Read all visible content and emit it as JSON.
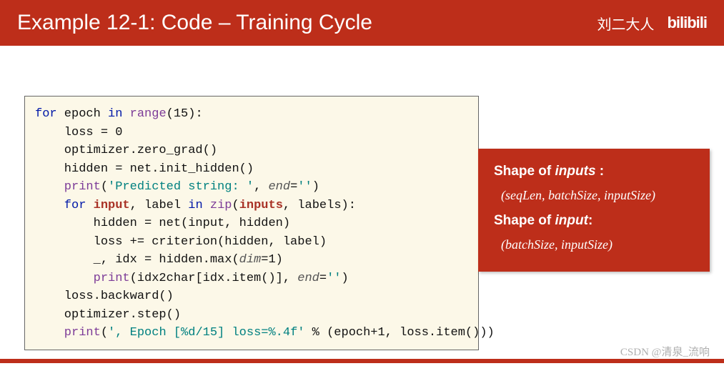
{
  "header": {
    "title": "Example 12-1: Code – Training Cycle",
    "author": "刘二大人",
    "logo": "bilibili"
  },
  "code": {
    "line1_for": "for",
    "line1_epoch": " epoch ",
    "line1_in": "in",
    "line1_range": " range",
    "line1_num": "15",
    "line2": "    loss = ",
    "line2_num": "0",
    "line3": "    optimizer.zero_grad()",
    "line4": "    hidden = net.init_hidden()",
    "line5_print": "    print",
    "line5_str": "'Predicted string: '",
    "line5_end": "end",
    "line5_endval": "''",
    "line6_for": "    for",
    "line6_input": "input",
    "line6_label": ", label ",
    "line6_in": "in",
    "line6_zip": " zip",
    "line6_inputs": "inputs",
    "line6_rest": ", labels):",
    "line7": "        hidden = net(input, hidden)",
    "line8": "        loss += criterion(hidden, label)",
    "line9a": "        _, idx = hidden.max(",
    "line9_dim": "dim",
    "line9b": "=",
    "line9_num": "1",
    "line9c": ")",
    "line10_print": "        print",
    "line10_body": "(idx2char[idx.item()], ",
    "line10_end": "end",
    "line10_endval": "''",
    "line10_close": ")",
    "line11": "    loss.backward()",
    "line12": "    optimizer.step()",
    "line13_print": "    print",
    "line13_str": "', Epoch [%d/15] loss=%.4f'",
    "line13_rest": " % (epoch+",
    "line13_num": "1",
    "line13_end": ", loss.item()))"
  },
  "callout": {
    "h1a": "Shape of ",
    "h1b": "inputs",
    "h1c": " :",
    "shape1": "(seqLen, batchSize, inputSize)",
    "h2a": "Shape of ",
    "h2b": "input",
    "h2c": ":",
    "shape2": "(batchSize, inputSize)"
  },
  "watermark": "CSDN @清泉_流响"
}
